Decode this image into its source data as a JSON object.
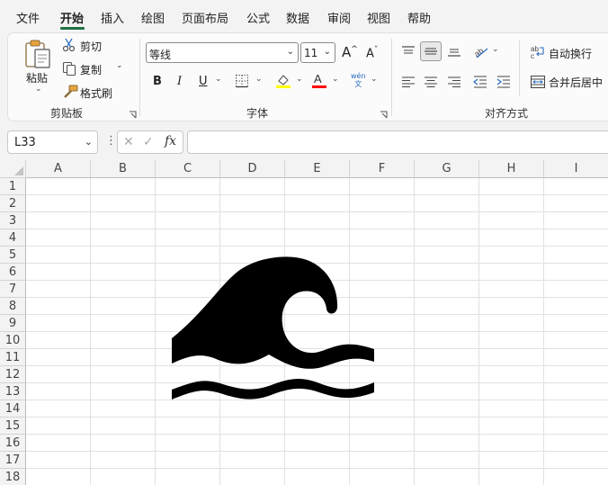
{
  "menu": {
    "items": [
      "文件",
      "开始",
      "插入",
      "绘图",
      "页面布局",
      "公式",
      "数据",
      "审阅",
      "视图",
      "帮助"
    ],
    "active": "开始"
  },
  "clipboard": {
    "paste_label": "粘贴",
    "cut_label": "剪切",
    "copy_label": "复制",
    "format_painter_label": "格式刷",
    "group_label": "剪贴板"
  },
  "font": {
    "font_name": "等线",
    "font_size": "11",
    "bold": "B",
    "italic": "I",
    "underline": "U",
    "phonetic_top": "wén",
    "phonetic_bottom": "文",
    "group_label": "字体",
    "highlight_color": "#ffff00",
    "font_color": "#ff0000"
  },
  "alignment": {
    "wrap_text_label": "自动换行",
    "merge_center_label": "合并后居中",
    "group_label": "对齐方式"
  },
  "formula_bar": {
    "name_box": "L33",
    "fx_label": "fx",
    "formula": ""
  },
  "sheet": {
    "columns": [
      "A",
      "B",
      "C",
      "D",
      "E",
      "F",
      "G",
      "H",
      "I"
    ],
    "rows": [
      "1",
      "2",
      "3",
      "4",
      "5",
      "6",
      "7",
      "8",
      "9",
      "10",
      "11",
      "12",
      "13",
      "14",
      "15",
      "16",
      "17",
      "18"
    ],
    "selected_cell": "L33",
    "image": "water-wave-icon"
  },
  "colors": {
    "accent": "#1e7145",
    "ribbon_bg": "#fbfbfb",
    "app_bg": "#f3f3f3"
  }
}
